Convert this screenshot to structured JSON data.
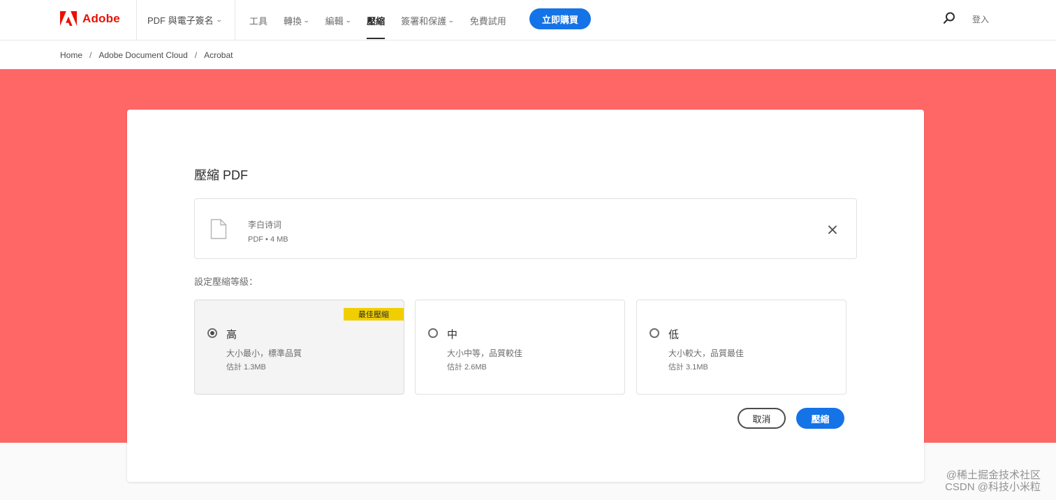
{
  "nav": {
    "brand": "Adobe",
    "product": "PDF 與電子簽名",
    "menu": [
      {
        "label": "工具",
        "has_dropdown": false,
        "active": false
      },
      {
        "label": "轉換",
        "has_dropdown": true,
        "active": false
      },
      {
        "label": "編輯",
        "has_dropdown": true,
        "active": false
      },
      {
        "label": "壓縮",
        "has_dropdown": false,
        "active": true
      },
      {
        "label": "簽署和保護",
        "has_dropdown": true,
        "active": false
      },
      {
        "label": "免費試用",
        "has_dropdown": false,
        "active": false
      }
    ],
    "buy_label": "立即購買",
    "search_icon": "search-icon",
    "login_label": "登入"
  },
  "breadcrumb": [
    "Home",
    "Adobe Document Cloud",
    "Acrobat"
  ],
  "dialog": {
    "title": "壓縮 PDF",
    "file": {
      "name": "李白诗词",
      "meta": "PDF • 4 MB",
      "icon": "document-icon",
      "close_icon": "close-icon"
    },
    "level_label": "設定壓縮等級：",
    "options": [
      {
        "title": "高",
        "desc": "大小最小，標準品質",
        "estimate": "估計 1.3MB",
        "badge": "最佳壓縮",
        "selected": true
      },
      {
        "title": "中",
        "desc": "大小中等，品質較佳",
        "estimate": "估計 2.6MB",
        "badge": "",
        "selected": false
      },
      {
        "title": "低",
        "desc": "大小較大，品質最佳",
        "estimate": "估計 3.1MB",
        "badge": "",
        "selected": false
      }
    ],
    "cancel_label": "取消",
    "compress_label": "壓縮"
  },
  "watermark": {
    "line1": "@稀土掘金技术社区",
    "line2": "CSDN @科技小米粒"
  },
  "colors": {
    "brand_red": "#eb1000",
    "hero_bg": "#ff6666",
    "accent_blue": "#1473e6",
    "badge_yellow": "#f0ce00"
  }
}
